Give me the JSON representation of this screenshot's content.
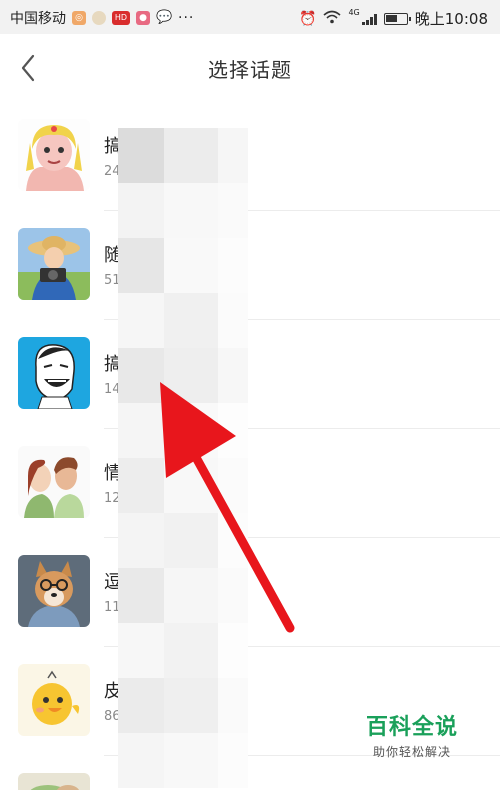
{
  "status_bar": {
    "carrier": "中国移动",
    "badge_icon": "HD",
    "dots": "···",
    "network": "4G",
    "time": "晚上10:08"
  },
  "header": {
    "title": "选择话题",
    "back_icon": "chevron-left-icon"
  },
  "topics": [
    {
      "name": "搞",
      "count": "24",
      "thumb": "cartoon-girl"
    },
    {
      "name": "随",
      "count": "51",
      "thumb": "camera-girl"
    },
    {
      "name": "搞",
      "count": "14",
      "thumb": "laughing-meme"
    },
    {
      "name": "情",
      "count": "12",
      "thumb": "couple"
    },
    {
      "name": "逗",
      "count": "11",
      "thumb": "dog-glasses"
    },
    {
      "name": "皮",
      "count": "86",
      "thumb": "yellow-chick"
    }
  ],
  "watermark": {
    "title": "百科全说",
    "subtitle": "助你轻松解决"
  },
  "colors": {
    "arrow": "#e8161c",
    "watermark": "#1aa05a",
    "status_bar_bg": "#f2f2f2"
  }
}
